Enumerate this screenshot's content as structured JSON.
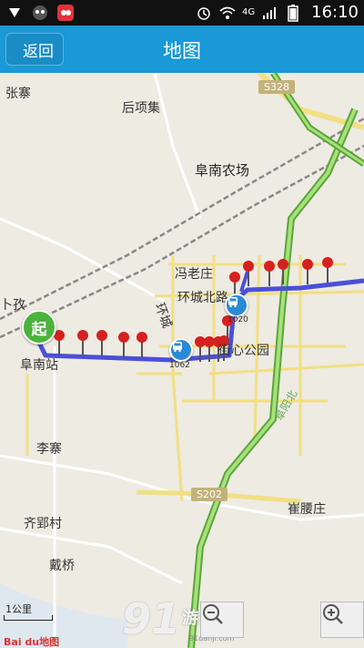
{
  "status": {
    "time": "16:10",
    "network": "4G",
    "icons": [
      "shield-icon",
      "owl-icon",
      "app-notification-icon",
      "alarm-icon",
      "wifi-icon",
      "signal-icon",
      "battery-icon"
    ]
  },
  "header": {
    "back_label": "返回",
    "title": "地图"
  },
  "map": {
    "places": [
      "张寨",
      "后项集",
      "阜南农场",
      "冯老庄",
      "环城北路",
      "阜南站",
      "环城",
      "街心公园",
      "李寨",
      "齐郢村",
      "崔腰庄",
      "戴桥",
      "阜阳北",
      "卜孜"
    ],
    "road_badges": [
      "S328",
      "S202"
    ],
    "bus_numbers": [
      "1062",
      "1020"
    ],
    "start_label": "起",
    "scale_label": "1公里",
    "logo": "Bai du地图"
  },
  "controls": {
    "zoom_out_icon": "zoom-out-icon",
    "zoom_in_icon": "zoom-in-icon"
  },
  "overlay": {
    "watermark": "91",
    "watermark_sub": "游戏",
    "watermark_url": "91danji.com"
  },
  "colors": {
    "header_bg": "#1b98d6",
    "route": "#4a4fd8",
    "highway": "#78c24f",
    "pin": "#d62020"
  }
}
